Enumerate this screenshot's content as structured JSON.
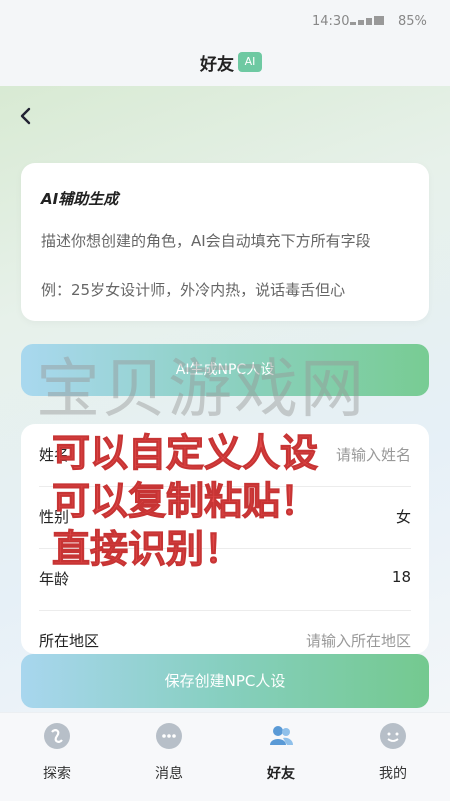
{
  "status": {
    "time": "14:30",
    "battery": "85%"
  },
  "header": {
    "title": "好友",
    "badge": "AI"
  },
  "ai_card": {
    "title": "AI辅助生成",
    "description": "描述你想创建的角色，AI会自动填充下方所有字段",
    "example": "例：25岁女设计师，外冷内热，说话毒舌但心"
  },
  "generate_button": "AI生成NPC人设",
  "form": {
    "name": {
      "label": "姓名",
      "placeholder": "请输入姓名"
    },
    "gender": {
      "label": "性别",
      "value": "女"
    },
    "age": {
      "label": "年龄",
      "value": "18"
    },
    "region": {
      "label": "所在地区",
      "placeholder": "请输入所在地区"
    }
  },
  "overlay": {
    "watermark": "宝贝游戏网",
    "promo": [
      "可以自定义人设",
      "可以复制粘贴！",
      "直接识别！"
    ]
  },
  "save_button": "保存创建NPC人设",
  "nav": [
    {
      "label": "探索",
      "icon": "explore-icon"
    },
    {
      "label": "消息",
      "icon": "message-icon"
    },
    {
      "label": "好友",
      "icon": "friends-icon",
      "active": true
    },
    {
      "label": "我的",
      "icon": "profile-icon"
    }
  ],
  "colors": {
    "accent_green": "#78cc93",
    "accent_blue": "#a8d6ee",
    "promo_red": "#e04848",
    "active_icon": "#5a9ad6"
  }
}
